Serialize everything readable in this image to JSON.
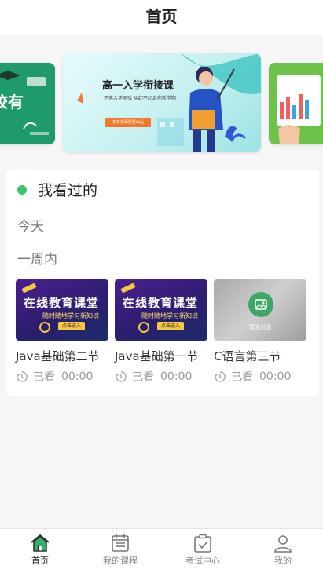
{
  "header": {
    "title": "首页"
  },
  "banners": [
    {
      "name": "left",
      "text": "校有"
    },
    {
      "name": "main",
      "title": "高一入学衔接课",
      "subtitle": "不落入学测验 从起不起走向新学期",
      "button": "享有资源限量出品"
    },
    {
      "name": "right"
    }
  ],
  "history": {
    "title": "我看过的",
    "groups": {
      "today": "今天",
      "week": "一周内"
    },
    "videos": [
      {
        "title": "Java基础第二节",
        "watched": "已看",
        "time": "00:00",
        "thumb_title": "在线教育课堂",
        "thumb_sub": "随时随地学习新知识",
        "thumb_btn": "点击进入"
      },
      {
        "title": "Java基础第一节",
        "watched": "已看",
        "time": "00:00",
        "thumb_title": "在线教育课堂",
        "thumb_sub": "随时随地学习新知识",
        "thumb_btn": "点击进入"
      },
      {
        "title": "C语言第三节",
        "watched": "已看",
        "time": "00:00",
        "thumb_label": "暂无封面"
      }
    ]
  },
  "tabs": [
    {
      "label": "首页",
      "active": true
    },
    {
      "label": "我的课程"
    },
    {
      "label": "考试中心"
    },
    {
      "label": "我的"
    }
  ],
  "colors": {
    "accent": "#3cc46d",
    "active_tab_icon": "#2fb36a"
  }
}
